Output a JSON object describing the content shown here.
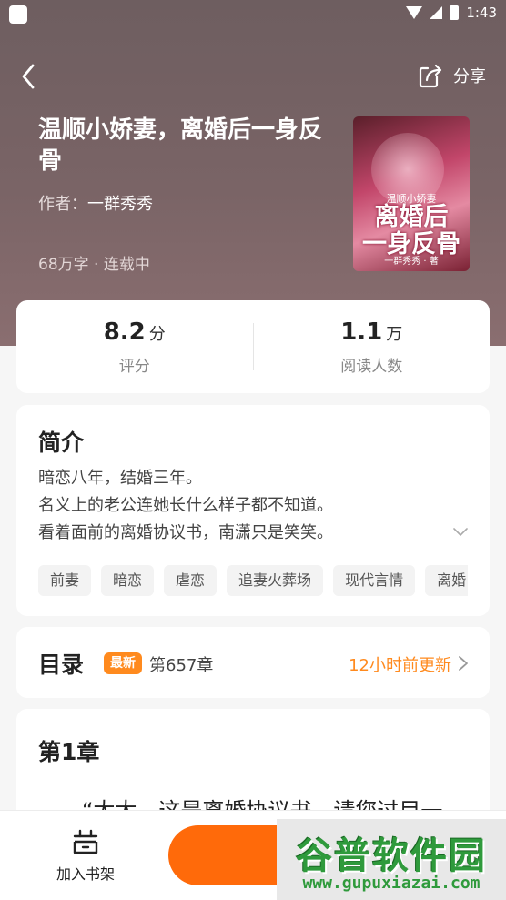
{
  "status_bar": {
    "time": "1:43"
  },
  "header": {
    "share_label": "分享"
  },
  "book": {
    "title": "温顺小娇妻，离婚后一身反骨",
    "author_prefix": "作者：",
    "author": "一群秀秀",
    "meta": "68万字 · 连载中",
    "cover": {
      "subtitle": "温顺小娇妻",
      "title_line1": "离婚后",
      "title_line2": "一身反骨",
      "byline": "一群秀秀 · 著"
    }
  },
  "stats": {
    "rating": {
      "value": "8.2",
      "unit": "分",
      "label": "评分"
    },
    "readers": {
      "value": "1.1",
      "unit": "万",
      "label": "阅读人数"
    }
  },
  "intro": {
    "heading": "简介",
    "lines": [
      "暗恋八年，结婚三年。",
      "名义上的老公连她长什么样子都不知道。",
      "看着面前的离婚协议书，南潇只是笑笑。"
    ],
    "tags": [
      "前妻",
      "暗恋",
      "虐恋",
      "追妻火葬场",
      "现代言情",
      "离婚"
    ]
  },
  "toc": {
    "heading": "目录",
    "badge": "最新",
    "latest_chapter": "第657章",
    "updated": "12小时前更新"
  },
  "chapter": {
    "heading": "第1章",
    "first_line": "“太太，这是离婚协议书，请您过目一"
  },
  "bottom_bar": {
    "shelf_label": "加入书架"
  },
  "watermark": {
    "main": "谷普软件园",
    "url": "www.gupuxiazai.com"
  }
}
